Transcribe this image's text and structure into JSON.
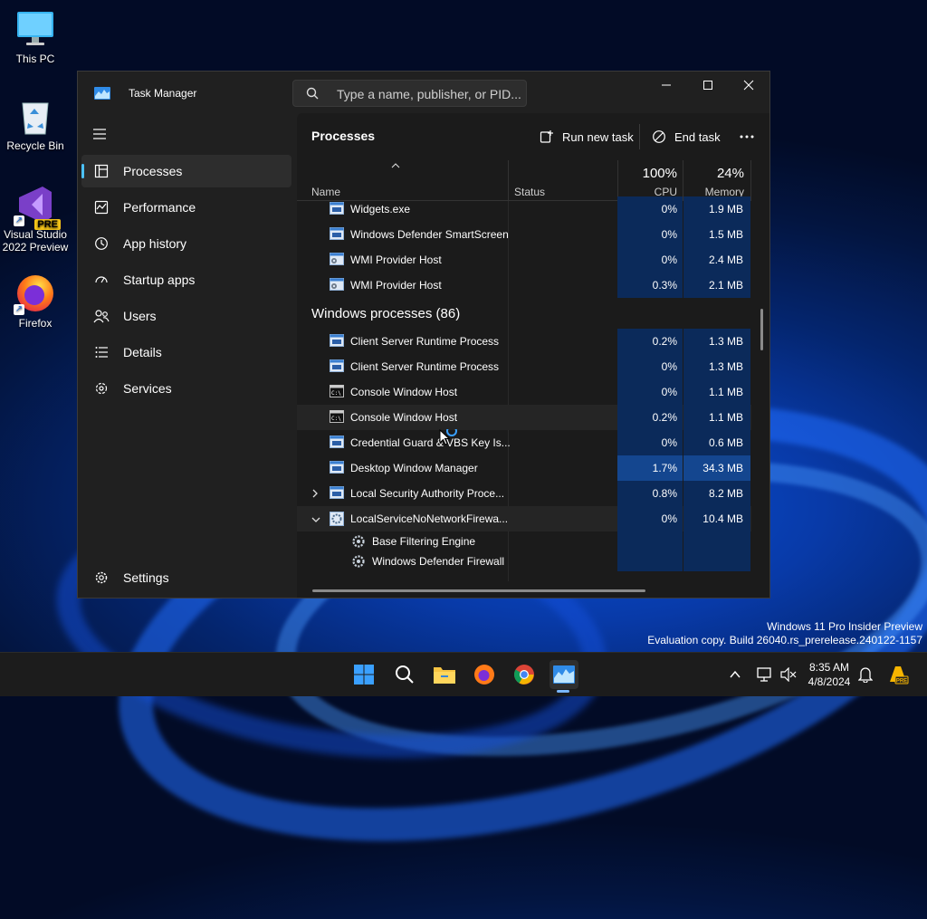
{
  "desktop": {
    "icons": [
      {
        "label": "This PC"
      },
      {
        "label": "Recycle Bin"
      },
      {
        "label": "Visual Studio 2022 Preview",
        "badge": "PRE"
      },
      {
        "label": "Firefox"
      }
    ],
    "watermark": {
      "line1": "Windows 11 Pro Insider Preview",
      "line2": "Evaluation copy. Build 26040.rs_prerelease.240122-1157"
    }
  },
  "window": {
    "title": "Task Manager",
    "search_placeholder": "Type a name, publisher, or PID..."
  },
  "nav": {
    "items": [
      {
        "label": "Processes",
        "icon": "processes-icon",
        "selected": true
      },
      {
        "label": "Performance",
        "icon": "performance-icon"
      },
      {
        "label": "App history",
        "icon": "history-icon"
      },
      {
        "label": "Startup apps",
        "icon": "startup-icon"
      },
      {
        "label": "Users",
        "icon": "users-icon"
      },
      {
        "label": "Details",
        "icon": "details-icon"
      },
      {
        "label": "Services",
        "icon": "services-icon"
      }
    ],
    "settings": "Settings"
  },
  "main": {
    "title": "Processes",
    "run_new_task": "Run new task",
    "end_task": "End task",
    "columns": {
      "name": "Name",
      "status": "Status",
      "cpu_pct": "100%",
      "cpu": "CPU",
      "mem_pct": "24%",
      "memory": "Memory"
    },
    "rows_top": [
      {
        "name": "Widgets.exe",
        "cpu": "0%",
        "mem": "1.9 MB",
        "icon": "window"
      },
      {
        "name": "Windows Defender SmartScreen",
        "cpu": "0%",
        "mem": "1.5 MB",
        "icon": "window"
      },
      {
        "name": "WMI Provider Host",
        "cpu": "0%",
        "mem": "2.4 MB",
        "icon": "wmi"
      },
      {
        "name": "WMI Provider Host",
        "cpu": "0.3%",
        "mem": "2.1 MB",
        "icon": "wmi"
      }
    ],
    "group": "Windows processes (86)",
    "rows_win": [
      {
        "name": "Client Server Runtime Process",
        "cpu": "0.2%",
        "mem": "1.3 MB",
        "icon": "window"
      },
      {
        "name": "Client Server Runtime Process",
        "cpu": "0%",
        "mem": "1.3 MB",
        "icon": "window"
      },
      {
        "name": "Console Window Host",
        "cpu": "0%",
        "mem": "1.1 MB",
        "icon": "console"
      },
      {
        "name": "Console Window Host",
        "cpu": "0.2%",
        "mem": "1.1 MB",
        "icon": "console"
      },
      {
        "name": "Credential Guard & VBS Key Is...",
        "cpu": "0%",
        "mem": "0.6 MB",
        "icon": "window"
      },
      {
        "name": "Desktop Window Manager",
        "cpu": "1.7%",
        "mem": "34.3 MB",
        "icon": "window"
      },
      {
        "name": "Local Security Authority Proce...",
        "cpu": "0.8%",
        "mem": "8.2 MB",
        "icon": "window",
        "expander": "collapsed"
      },
      {
        "name": "LocalServiceNoNetworkFirewa...",
        "cpu": "0%",
        "mem": "10.4 MB",
        "icon": "service",
        "expander": "expanded"
      }
    ],
    "sub_rows": [
      {
        "name": "Base Filtering Engine"
      },
      {
        "name": "Windows Defender Firewall"
      }
    ]
  },
  "taskbar": {
    "time": "8:35 AM",
    "date": "4/8/2024"
  },
  "colors": {
    "accent": "#4cc2ff",
    "cpu_heat": "#0b2a5a",
    "cpu_heat_high": "#14468f"
  }
}
